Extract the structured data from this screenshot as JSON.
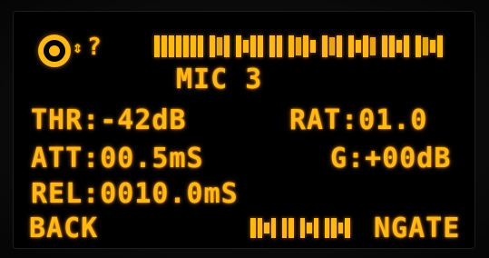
{
  "header": {
    "icon_status": "?",
    "icon_link": "⇕",
    "title": "MIC 3"
  },
  "params": {
    "thr": "THR:-42dB",
    "rat": "RAT:01.0",
    "att": "ATT:00.5mS",
    "gain": "G:+00dB",
    "rel": "REL:0010.0mS"
  },
  "footer": {
    "back_label": "BACK",
    "mode_label": "NGATE"
  },
  "colors": {
    "display": "#ffb81a",
    "background": "#000000"
  }
}
